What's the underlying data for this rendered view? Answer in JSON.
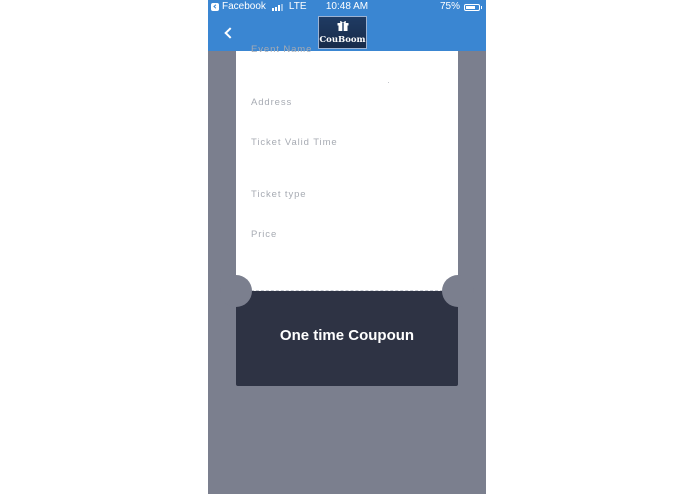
{
  "status_bar": {
    "back_app": "Facebook",
    "network": "LTE",
    "time": "10:48 AM",
    "battery_percent": "75%",
    "battery_level": 0.75,
    "signal_bars": 3,
    "signal_bars_total": 4
  },
  "nav": {
    "logo_text": "CouBoom",
    "back_icon": "chevron-left-icon"
  },
  "ticket": {
    "fields": [
      {
        "label": "Event Name"
      },
      {
        "label": "Address"
      },
      {
        "label": "Ticket Valid Time"
      },
      {
        "label": "Ticket type"
      },
      {
        "label": "Price"
      }
    ],
    "footer_title": "One time Coupoun"
  },
  "colors": {
    "nav_blue": "#3a86d2",
    "background_gray": "#7b7f8e",
    "coupon_dark": "#2e3344",
    "label_gray": "#a7abb3"
  }
}
